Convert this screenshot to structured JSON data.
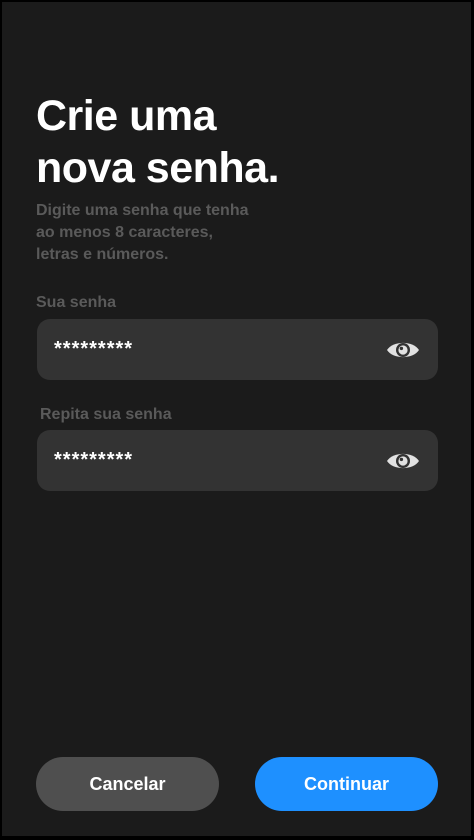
{
  "header": {
    "title_line1": "Crie uma",
    "title_line2": "nova senha.",
    "subtitle_line1": "Digite uma senha que tenha",
    "subtitle_line2": "ao menos 8 caracteres,",
    "subtitle_line3": "letras e números."
  },
  "form": {
    "password": {
      "label": "Sua senha",
      "value": "*********",
      "icon": "eye-icon"
    },
    "confirm_password": {
      "label": "Repita sua senha",
      "value": "*********",
      "icon": "eye-icon"
    }
  },
  "actions": {
    "cancel_label": "Cancelar",
    "continue_label": "Continuar"
  },
  "colors": {
    "background": "#1b1b1b",
    "field_background": "#333333",
    "muted_text": "#5a5a5a",
    "cancel_button": "#4f4f4f",
    "accent": "#1e90ff"
  }
}
